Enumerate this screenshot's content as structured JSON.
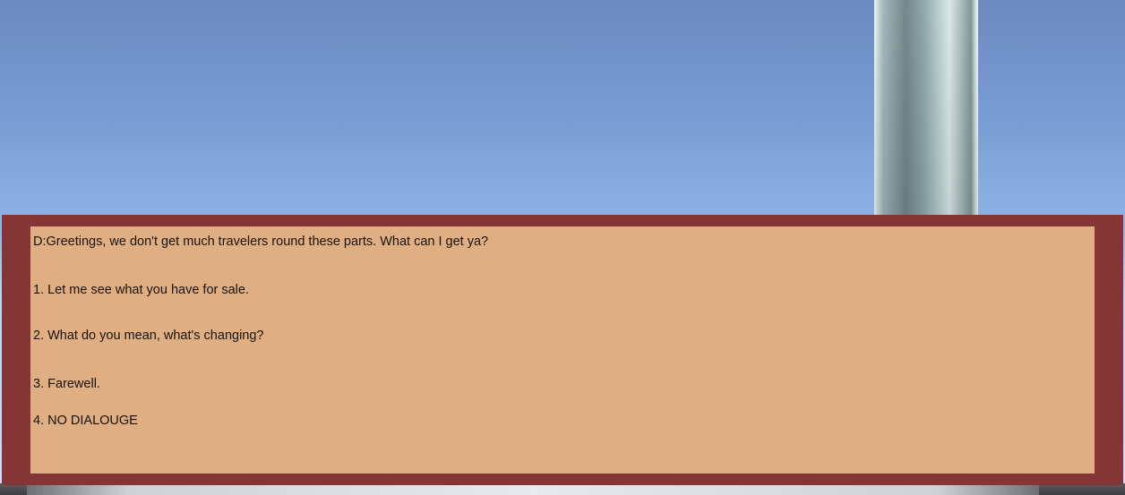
{
  "dialogue": {
    "prompt": "D:Greetings, we don't get much travelers round these parts. What can I get ya?",
    "options": [
      {
        "label": "1. Let me see what you have for sale."
      },
      {
        "label": "2. What do you mean, what's changing?"
      },
      {
        "label": "3. Farewell."
      },
      {
        "label": "4. NO DIALOUGE"
      }
    ]
  },
  "colors": {
    "sky_top": "#6a8ac0",
    "sky_bottom": "#c9e0ff",
    "frame": "#863537",
    "panel": "#dfae82",
    "text": "#1a1208"
  }
}
